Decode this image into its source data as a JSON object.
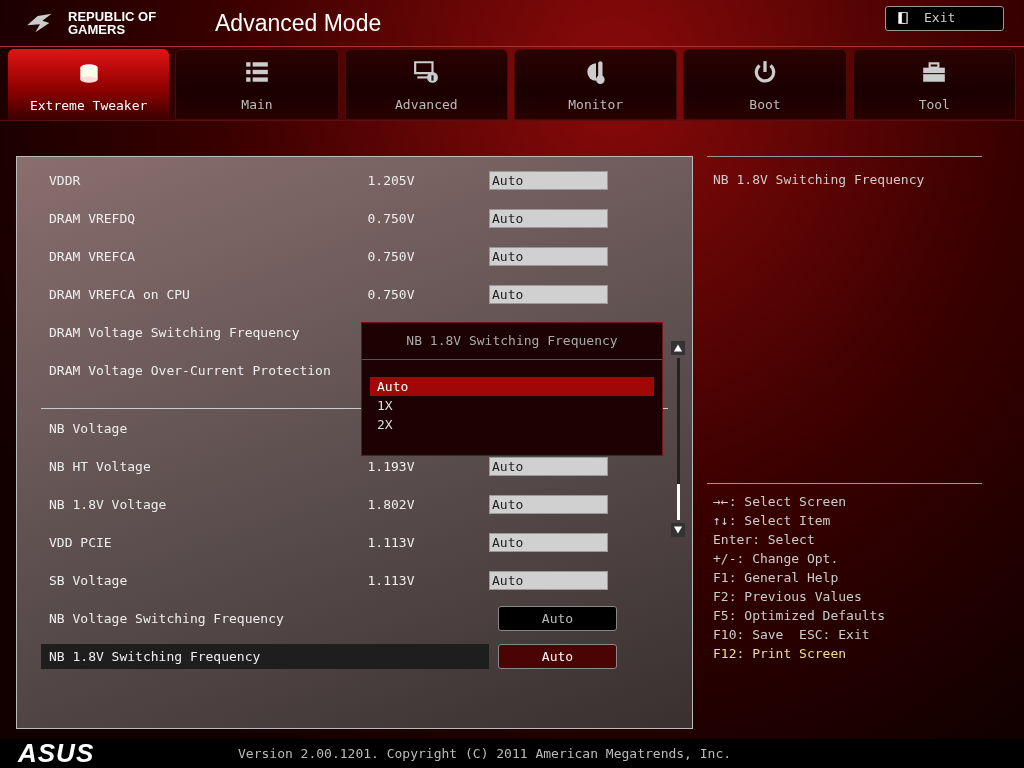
{
  "header": {
    "brand_line_1": "REPUBLIC OF",
    "brand_line_2": "GAMERS",
    "title": "Advanced Mode",
    "exit_button": "Exit"
  },
  "tabs": [
    {
      "label": "Extreme Tweaker",
      "selected": true
    },
    {
      "label": "Main",
      "selected": false
    },
    {
      "label": "Advanced",
      "selected": false
    },
    {
      "label": "Monitor",
      "selected": false
    },
    {
      "label": "Boot",
      "selected": false
    },
    {
      "label": "Tool",
      "selected": false
    }
  ],
  "settings": [
    {
      "kind": "value",
      "label": "VDDR",
      "reading": "1.205V",
      "value": "Auto",
      "selected": false
    },
    {
      "kind": "value",
      "label": "DRAM VREFDQ",
      "reading": "0.750V",
      "value": "Auto",
      "selected": false
    },
    {
      "kind": "value",
      "label": "DRAM VREFCA",
      "reading": "0.750V",
      "value": "Auto",
      "selected": false
    },
    {
      "kind": "value",
      "label": "DRAM VREFCA on CPU",
      "reading": "0.750V",
      "value": "Auto",
      "selected": false
    },
    {
      "kind": "label",
      "label": "DRAM Voltage Switching Frequency",
      "selected": false
    },
    {
      "kind": "label",
      "label": "DRAM Voltage Over-Current Protection",
      "selected": false
    },
    {
      "kind": "separator"
    },
    {
      "kind": "label",
      "label": "NB Voltage",
      "selected": false
    },
    {
      "kind": "value",
      "label": "NB HT Voltage",
      "reading": "1.193V",
      "value": "Auto",
      "selected": false
    },
    {
      "kind": "value",
      "label": "NB 1.8V Voltage",
      "reading": "1.802V",
      "value": "Auto",
      "selected": false
    },
    {
      "kind": "value",
      "label": "VDD PCIE",
      "reading": "1.113V",
      "value": "Auto",
      "selected": false
    },
    {
      "kind": "value",
      "label": "SB Voltage",
      "reading": "1.113V",
      "value": "Auto",
      "selected": false
    },
    {
      "kind": "option",
      "label": "NB Voltage Switching Frequency",
      "value": "Auto",
      "selected": false
    },
    {
      "kind": "option",
      "label": "NB 1.8V Switching Frequency",
      "value": "Auto",
      "selected": true
    }
  ],
  "popup": {
    "title": "NB 1.8V Switching Frequency",
    "options": [
      {
        "label": "Auto",
        "selected": true
      },
      {
        "label": "1X",
        "selected": false
      },
      {
        "label": "2X",
        "selected": false
      }
    ]
  },
  "help": {
    "description": "NB 1.8V Switching Frequency",
    "keys": [
      {
        "text": "→←: Select Screen",
        "highlighted": false
      },
      {
        "text": "↑↓: Select Item",
        "highlighted": false
      },
      {
        "text": "Enter: Select",
        "highlighted": false
      },
      {
        "text": "+/-: Change Opt.",
        "highlighted": false
      },
      {
        "text": "F1: General Help",
        "highlighted": false
      },
      {
        "text": "F2: Previous Values",
        "highlighted": false
      },
      {
        "text": "F5: Optimized Defaults",
        "highlighted": false
      },
      {
        "text": "F10: Save  ESC: Exit",
        "highlighted": false
      },
      {
        "text": "F12: Print Screen",
        "highlighted": true
      }
    ]
  },
  "footer": {
    "logo": "ASUS",
    "version": "Version 2.00.1201. Copyright (C) 2011 American Megatrends, Inc."
  }
}
